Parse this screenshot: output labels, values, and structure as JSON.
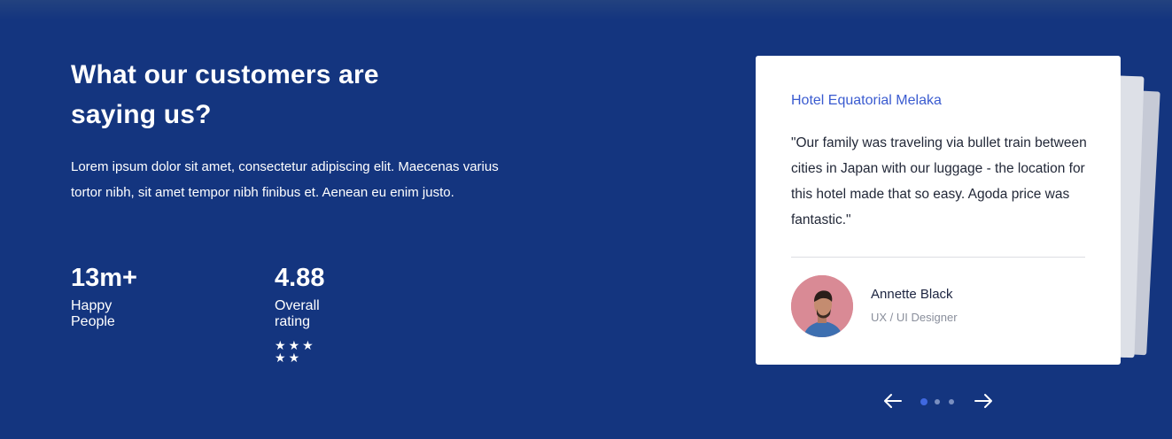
{
  "section": {
    "heading": "What our customers are saying us?",
    "description": "Lorem ipsum dolor sit amet, consectetur adipiscing elit. Maecenas varius tortor nibh, sit amet tempor nibh finibus et. Aenean eu enim justo."
  },
  "stats": [
    {
      "value": "13m+",
      "label": "Happy People"
    },
    {
      "value": "4.88",
      "label": "Overall rating",
      "stars": 5
    }
  ],
  "testimonial": {
    "hotel": "Hotel Equatorial Melaka",
    "quote": "\"Our family was traveling via bullet train between cities in Japan with our luggage - the location for this hotel made that so easy. Agoda price was fantastic.\"",
    "author_name": "Annette Black",
    "author_role": "UX / UI Designer"
  },
  "slider": {
    "slide_count": 3,
    "active_index": 0,
    "prev_icon": "arrow-left-icon",
    "next_icon": "arrow-right-icon"
  },
  "colors": {
    "background": "#14357f",
    "accent": "#3a5bd0",
    "card": "#ffffff"
  }
}
